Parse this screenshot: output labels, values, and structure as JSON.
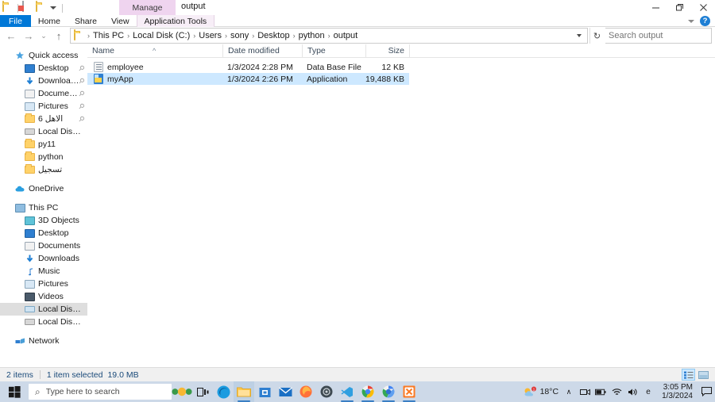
{
  "window": {
    "title": "output",
    "quick_access": [
      "folder-icon",
      "properties-icon",
      "new-folder-icon",
      "customize-dropdown-icon"
    ],
    "contextual_tab": "Manage",
    "controls": {
      "minimize": "minimize-icon",
      "restore": "restore-icon",
      "close": "close-icon"
    },
    "help_label": "?"
  },
  "ribbon": {
    "tabs": [
      {
        "label": "File"
      },
      {
        "label": "Home"
      },
      {
        "label": "Share"
      },
      {
        "label": "View"
      },
      {
        "label": "Application Tools"
      }
    ]
  },
  "address": {
    "back": "back-arrow-icon",
    "forward": "forward-arrow-icon",
    "recent": "recent-locations-icon",
    "up": "up-arrow-icon",
    "crumbs": [
      "This PC",
      "Local Disk (C:)",
      "Users",
      "sony",
      "Desktop",
      "python",
      "output"
    ],
    "separator": "›",
    "refresh": "↻"
  },
  "search": {
    "placeholder": "Search output",
    "value": "",
    "icon": "search-icon"
  },
  "navpane": {
    "groups": [
      {
        "name": "quick-access",
        "header": {
          "label": "Quick access",
          "icon": "star-icon"
        },
        "items": [
          {
            "label": "Desktop",
            "icon": "desktop-icon",
            "pinned": true
          },
          {
            "label": "Downloads",
            "icon": "downloads-icon",
            "pinned": true
          },
          {
            "label": "Documents",
            "icon": "documents-icon",
            "pinned": true
          },
          {
            "label": "Pictures",
            "icon": "pictures-icon",
            "pinned": true
          },
          {
            "label": "الاهل 6",
            "icon": "folder-icon",
            "pinned": true
          },
          {
            "label": "Local Disk (D:)",
            "icon": "drive-icon",
            "pinned": false
          },
          {
            "label": "py11",
            "icon": "folder-icon",
            "pinned": false
          },
          {
            "label": "python",
            "icon": "folder-icon",
            "pinned": false
          },
          {
            "label": "تسجيل",
            "icon": "folder-icon",
            "pinned": false
          }
        ]
      },
      {
        "name": "onedrive",
        "header": {
          "label": "OneDrive",
          "icon": "cloud-icon"
        },
        "items": []
      },
      {
        "name": "this-pc",
        "header": {
          "label": "This PC",
          "icon": "computer-icon"
        },
        "items": [
          {
            "label": "3D Objects",
            "icon": "3d-objects-icon",
            "selected": false
          },
          {
            "label": "Desktop",
            "icon": "desktop-icon",
            "selected": false
          },
          {
            "label": "Documents",
            "icon": "documents-icon",
            "selected": false
          },
          {
            "label": "Downloads",
            "icon": "downloads-icon",
            "selected": false
          },
          {
            "label": "Music",
            "icon": "music-icon",
            "selected": false
          },
          {
            "label": "Pictures",
            "icon": "pictures-icon",
            "selected": false
          },
          {
            "label": "Videos",
            "icon": "videos-icon",
            "selected": false
          },
          {
            "label": "Local Disk (C:)",
            "icon": "windows-drive-icon",
            "selected": true
          },
          {
            "label": "Local Disk (D:)",
            "icon": "drive-icon",
            "selected": false
          }
        ]
      },
      {
        "name": "network",
        "header": {
          "label": "Network",
          "icon": "network-icon"
        },
        "items": []
      }
    ]
  },
  "filelist": {
    "columns": [
      {
        "key": "name",
        "label": "Name",
        "sorted": "asc",
        "sort_glyph": "^"
      },
      {
        "key": "date",
        "label": "Date modified"
      },
      {
        "key": "type",
        "label": "Type"
      },
      {
        "key": "size",
        "label": "Size"
      }
    ],
    "rows": [
      {
        "name": "employee",
        "date": "1/3/2024 2:28 PM",
        "type": "Data Base File",
        "size": "12 KB",
        "icon": "database-file-icon",
        "selected": false
      },
      {
        "name": "myApp",
        "date": "1/3/2024 2:26 PM",
        "type": "Application",
        "size": "19,488 KB",
        "icon": "application-icon",
        "selected": true
      }
    ]
  },
  "statusbar": {
    "item_count": "2 items",
    "selection": "1 item selected",
    "selection_size": "19.0 MB",
    "views": [
      {
        "name": "details-view",
        "icon": "details-view-icon",
        "active": true
      },
      {
        "name": "large-icons-view",
        "icon": "large-icons-view-icon",
        "active": false
      }
    ]
  },
  "taskbar": {
    "start": "windows-start-icon",
    "search_placeholder": "Type here to search",
    "widget": "weather-widget-icon",
    "taskview": "task-view-icon",
    "apps": [
      {
        "name": "edge",
        "icon": "edge-icon",
        "running": false
      },
      {
        "name": "file-explorer",
        "icon": "file-explorer-icon",
        "running": true,
        "active": true
      },
      {
        "name": "microsoft-store",
        "icon": "microsoft-store-icon",
        "running": false
      },
      {
        "name": "mail",
        "icon": "mail-icon",
        "running": false
      },
      {
        "name": "firefox",
        "icon": "firefox-icon",
        "running": false
      },
      {
        "name": "tor-browser",
        "icon": "tor-browser-icon",
        "running": false
      },
      {
        "name": "vs-code",
        "icon": "vs-code-icon",
        "running": true
      },
      {
        "name": "chrome",
        "icon": "chrome-icon",
        "running": true
      },
      {
        "name": "chrome-beta",
        "icon": "chrome-beta-icon",
        "running": true
      },
      {
        "name": "xampp",
        "icon": "xampp-icon",
        "running": true
      }
    ],
    "tray": {
      "weather_temp": "18°C",
      "chevron": "show-hidden-icons-icon",
      "icons": [
        "camera-icon",
        "battery-icon",
        "wifi-icon",
        "volume-icon",
        "onedrive-tray-icon"
      ],
      "time": "3:05 PM",
      "date": "1/3/2024",
      "notifications": "notification-center-icon"
    }
  }
}
